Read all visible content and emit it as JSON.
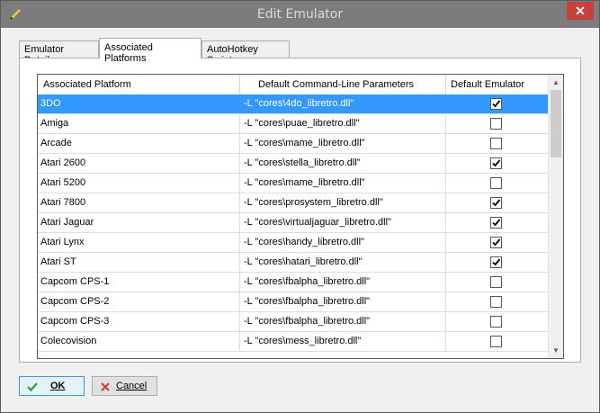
{
  "window": {
    "title": "Edit Emulator",
    "close_label": "✕"
  },
  "tabs": [
    {
      "label": "Emulator Details",
      "active": false
    },
    {
      "label": "Associated Platforms",
      "active": true
    },
    {
      "label": "AutoHotkey Script",
      "active": false
    }
  ],
  "grid": {
    "columns": [
      "Associated Platform",
      "Default Command-Line Parameters",
      "Default Emulator"
    ],
    "rows": [
      {
        "platform": "3DO",
        "params": "-L \"cores\\4do_libretro.dll\"",
        "default": true,
        "selected": true
      },
      {
        "platform": "Amiga",
        "params": "-L \"cores\\puae_libretro.dll\"",
        "default": false
      },
      {
        "platform": "Arcade",
        "params": "-L \"cores\\mame_libretro.dll\"",
        "default": false
      },
      {
        "platform": "Atari 2600",
        "params": "-L \"cores\\stella_libretro.dll\"",
        "default": true
      },
      {
        "platform": "Atari 5200",
        "params": "-L \"cores\\mame_libretro.dll\"",
        "default": false
      },
      {
        "platform": "Atari 7800",
        "params": "-L \"cores\\prosystem_libretro.dll\"",
        "default": true
      },
      {
        "platform": "Atari Jaguar",
        "params": "-L \"cores\\virtualjaguar_libretro.dll\"",
        "default": true
      },
      {
        "platform": "Atari Lynx",
        "params": "-L \"cores\\handy_libretro.dll\"",
        "default": true
      },
      {
        "platform": "Atari ST",
        "params": "-L \"cores\\hatari_libretro.dll\"",
        "default": true
      },
      {
        "platform": "Capcom CPS-1",
        "params": "-L \"cores\\fbalpha_libretro.dll\"",
        "default": false
      },
      {
        "platform": "Capcom CPS-2",
        "params": "-L \"cores\\fbalpha_libretro.dll\"",
        "default": false
      },
      {
        "platform": "Capcom CPS-3",
        "params": "-L \"cores\\fbalpha_libretro.dll\"",
        "default": false
      },
      {
        "platform": "Colecovision",
        "params": "-L \"cores\\mess_libretro.dll\"",
        "default": false
      }
    ]
  },
  "buttons": {
    "ok_label": "OK",
    "cancel_label": "Cancel"
  },
  "colors": {
    "selection": "#3399ff",
    "close_button": "#c7403a",
    "titlebar": "#7c7c7c"
  }
}
